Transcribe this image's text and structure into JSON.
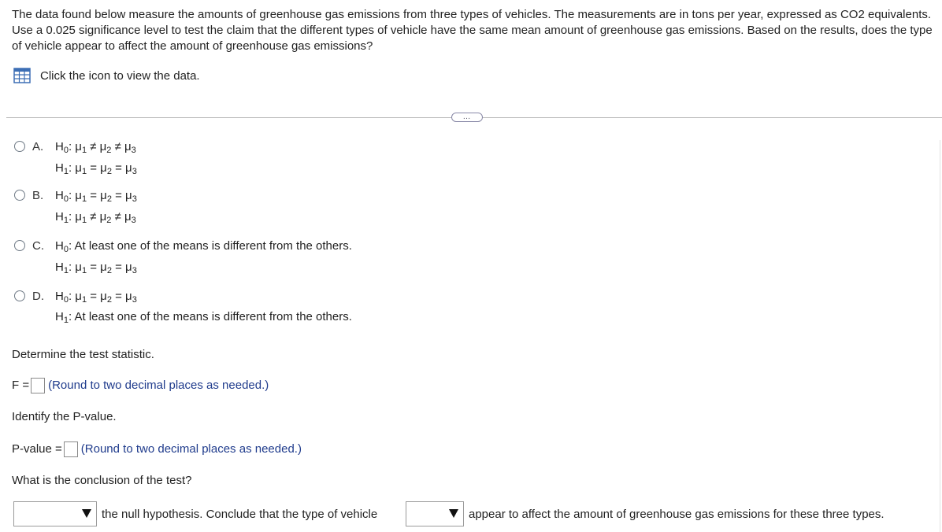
{
  "intro": "The data found below measure the amounts of greenhouse gas emissions from three types of vehicles. The measurements are in tons per year, expressed as CO2 equivalents. Use a 0.025 significance level to test the claim that the different types of vehicle have the same mean amount of greenhouse gas emissions. Based on the results, does the type of vehicle appear to affect the amount of greenhouse gas emissions?",
  "data_link": {
    "label": "Click the icon to view the data.",
    "icon": "table-grid-icon"
  },
  "more_button": "…",
  "options": [
    {
      "letter": "A.",
      "h0": [
        "H",
        "0",
        ": μ",
        "1",
        " ≠ μ",
        "2",
        " ≠ μ",
        "3"
      ],
      "h1": [
        "H",
        "1",
        ": μ",
        "1",
        " = μ",
        "2",
        " = μ",
        "3"
      ]
    },
    {
      "letter": "B.",
      "h0": [
        "H",
        "0",
        ": μ",
        "1",
        " = μ",
        "2",
        " = μ",
        "3"
      ],
      "h1": [
        "H",
        "1",
        ": μ",
        "1",
        " ≠ μ",
        "2",
        " ≠ μ",
        "3"
      ]
    },
    {
      "letter": "C.",
      "h0_text": "At least one of the means is different from the others.",
      "h1": [
        "H",
        "1",
        ": μ",
        "1",
        " = μ",
        "2",
        " = μ",
        "3"
      ]
    },
    {
      "letter": "D.",
      "h0": [
        "H",
        "0",
        ": μ",
        "1",
        " = μ",
        "2",
        " = μ",
        "3"
      ],
      "h1_text": "At least one of the means is different from the others."
    }
  ],
  "h_labels": {
    "H": "H",
    "sub0": "0",
    "sub1": "1",
    "colon": ":"
  },
  "questions": {
    "test_stat": "Determine the test statistic.",
    "f_label": "F =",
    "f_hint": "(Round to two decimal places as needed.)",
    "pvalue_q": "Identify the P-value.",
    "p_label": "P-value =",
    "p_hint": "(Round to two decimal places as needed.)",
    "conclusion_q": "What is the conclusion of the test?",
    "concl_mid": "the null hypothesis. Conclude that the type of vehicle",
    "concl_end": "appear to affect the amount of greenhouse gas emissions for these three types."
  }
}
